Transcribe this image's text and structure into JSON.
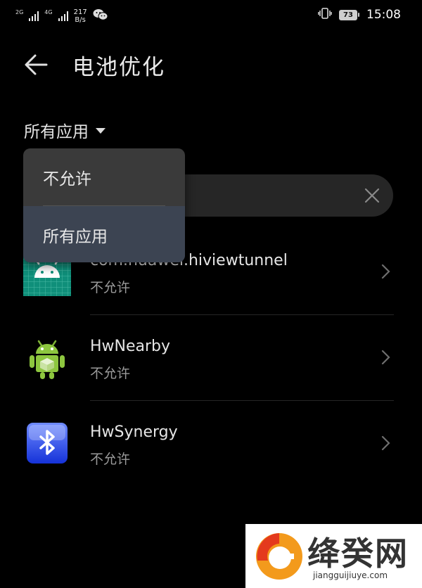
{
  "status_bar": {
    "net1": "2G",
    "net2": "4G",
    "speed_value": "217",
    "speed_unit": "B/s",
    "battery": "73",
    "time": "15:08"
  },
  "header": {
    "title": "电池优化"
  },
  "filter": {
    "label": "所有应用"
  },
  "dropdown": {
    "options": [
      {
        "label": "不允许",
        "selected": false
      },
      {
        "label": "所有应用",
        "selected": true
      }
    ]
  },
  "apps": [
    {
      "name": "com.huawei.hiviewtunnel",
      "status": "不允许",
      "icon": "android-robot-icon"
    },
    {
      "name": "HwNearby",
      "status": "不允许",
      "icon": "android-box-icon"
    },
    {
      "name": "HwSynergy",
      "status": "不允许",
      "icon": "bluetooth-icon"
    }
  ],
  "watermark": {
    "title": "绛癸网",
    "url": "jiangguijiuye.com"
  },
  "colors": {
    "background": "#000000",
    "dropdown": "#3a3a3a",
    "dropdown_selected": "#3c4452",
    "search_bg": "#262626"
  }
}
